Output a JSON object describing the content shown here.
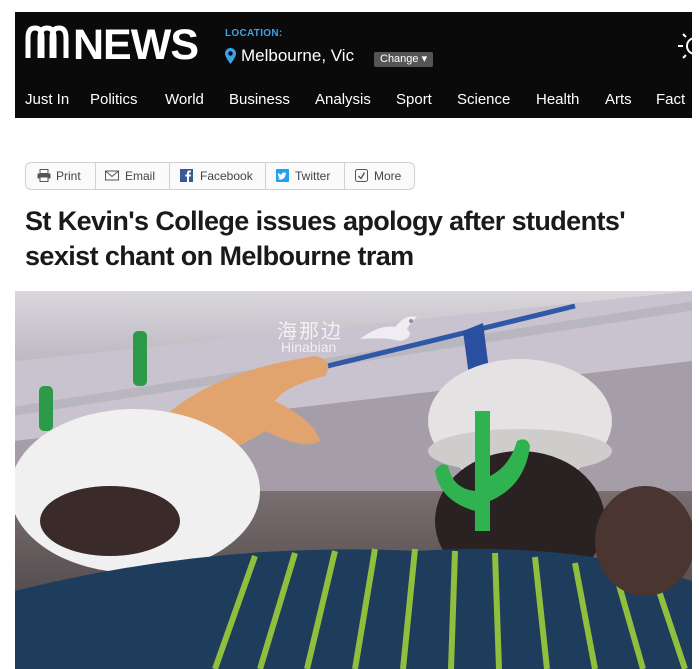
{
  "header": {
    "brand": "NEWS",
    "location_label": "LOCATION:",
    "location_value": "Melbourne, Vic",
    "change_label": "Change ▾",
    "nav": [
      "Just In",
      "Politics",
      "World",
      "Business",
      "Analysis",
      "Sport",
      "Science",
      "Health",
      "Arts",
      "Fact"
    ]
  },
  "share": {
    "print": "Print",
    "email": "Email",
    "facebook": "Facebook",
    "twitter": "Twitter",
    "more": "More"
  },
  "article": {
    "headline": "St Kevin's College issues apology after students' sexist chant on Melbourne tram"
  },
  "photo": {
    "watermark_cn": "海那边",
    "watermark_en": "Hinabian"
  },
  "colors": {
    "header_bg": "#0a0a0a",
    "location_accent": "#3aa3e6",
    "facebook": "#3b5998",
    "twitter": "#1da1f2"
  }
}
